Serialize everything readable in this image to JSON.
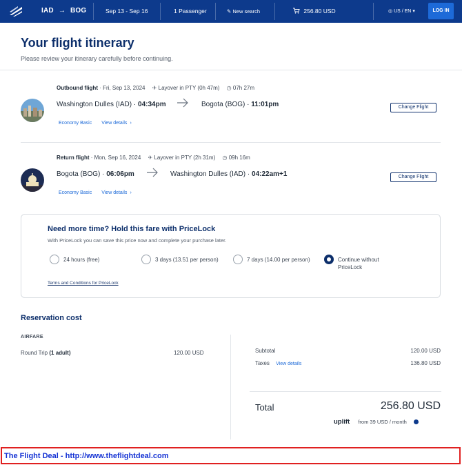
{
  "header": {
    "origin": "IAD",
    "destination": "BOG",
    "dates": "Sep 13 - Sep 16",
    "passengers": "1 Passenger",
    "new_search": "New search",
    "cart_total": "256.80 USD",
    "locale": "US / EN",
    "login": "LOG IN"
  },
  "page": {
    "title": "Your flight itinerary",
    "subtitle": "Please review your itinerary carefully before continuing."
  },
  "outbound": {
    "label": "Outbound flight",
    "date": "· Fri, Sep 13, 2024",
    "layover": "Layover in PTY (0h 47m)",
    "duration": "07h 27m",
    "from_city": "Washington Dulles (IAD) ·",
    "from_time": "04:34pm",
    "to_city": "Bogota (BOG) ·",
    "to_time": "11:01pm",
    "fare": "Economy Basic",
    "details": "View details",
    "change": "Change Flight"
  },
  "return": {
    "label": "Return flight",
    "date": "· Mon, Sep 16, 2024",
    "layover": "Layover in PTY (2h 31m)",
    "duration": "09h 16m",
    "from_city": "Bogota (BOG) ·",
    "from_time": "06:06pm",
    "to_city": "Washington Dulles (IAD) ·",
    "to_time": "04:22am+1",
    "fare": "Economy Basic",
    "details": "View details",
    "change": "Change Flight"
  },
  "pricelock": {
    "title": "Need more time? Hold this fare with PriceLock",
    "description": "With PriceLock you can save this price now and complete your purchase later.",
    "options": [
      {
        "label": "24 hours (free)",
        "selected": false
      },
      {
        "label": "3 days (13.51 per person)",
        "selected": false
      },
      {
        "label": "7 days (14.00 per person)",
        "selected": false
      },
      {
        "label": "Continue without",
        "label2": "PriceLock",
        "selected": true
      }
    ],
    "terms": "Terms and Conditions for PriceLock"
  },
  "reservation": {
    "title": "Reservation cost",
    "airfare_label": "AIRFARE",
    "trip_label": "Round Trip",
    "trip_qty": "(1 adult)",
    "trip_price": "120.00 USD",
    "subtotal_label": "Subtotal",
    "subtotal_value": "120.00 USD",
    "taxes_label": "Taxes",
    "taxes_link": "View details",
    "taxes_value": "136.80 USD",
    "total_label": "Total",
    "total_value": "256.80 USD",
    "uplift_logo": "uplift",
    "uplift_text": "from 39 USD / month"
  },
  "footer": {
    "banner": "The Flight Deal - http://www.theflightdeal.com"
  },
  "colors": {
    "brand": "#0d3a8c",
    "accent": "#1d6ad8",
    "banner_border": "#e02020",
    "banner_text": "#1432d4"
  }
}
